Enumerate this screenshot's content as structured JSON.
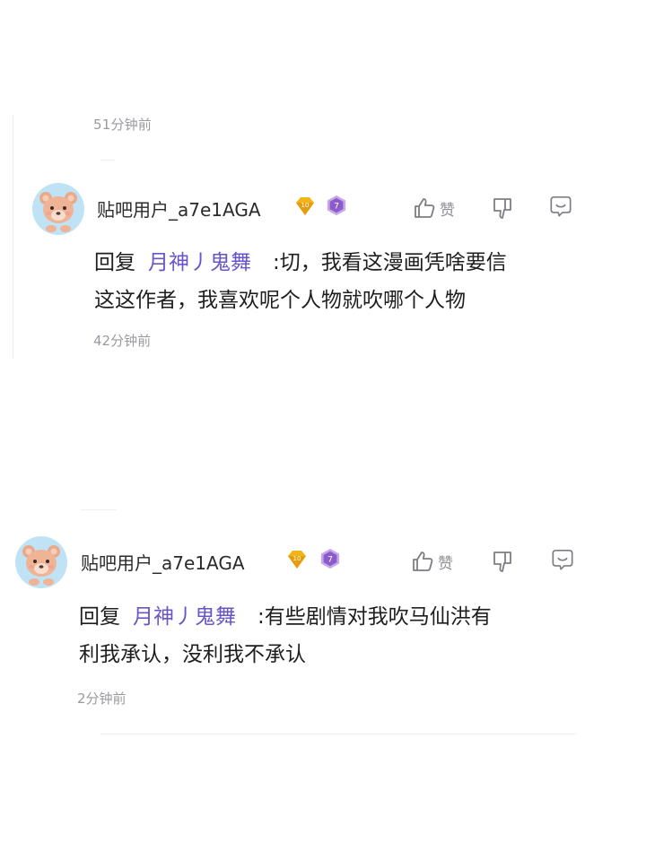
{
  "top_timestamp": "51分钟前",
  "comments": [
    {
      "username": "贴吧用户_a7e1AGA",
      "like_label": "赞",
      "reply_prefix": "回复",
      "mention": "月神丿鬼舞",
      "text_line1": ":切，我看这漫画凭啥要信",
      "text_line2": "这这作者，我喜欢呢个人物就吹哪个人物",
      "time": "42分钟前",
      "level_badge": "7",
      "vip_badge": "10"
    },
    {
      "username": "贴吧用户_a7e1AGA",
      "like_label": "赞",
      "reply_prefix": "回复",
      "mention": "月神丿鬼舞",
      "text_line1": ":有些剧情对我吹马仙洪有",
      "text_line2": "利我承认，没利我不承认",
      "time": "2分钟前",
      "level_badge": "7",
      "vip_badge": "10"
    }
  ],
  "colors": {
    "mention": "#6a55c8",
    "muted": "#9a9aa0",
    "level_badge": "#8b5cc9",
    "vip_badge": "#f2b518"
  }
}
